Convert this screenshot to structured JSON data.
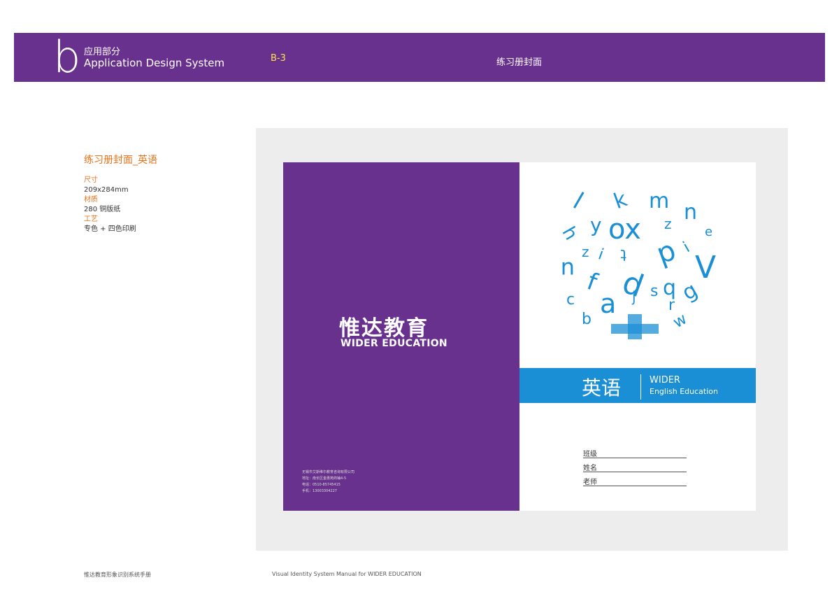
{
  "header": {
    "section_letter": "b",
    "section_cn": "应用部分",
    "section_en": "Application Design System",
    "page_code": "B-3",
    "page_title": "练习册封面"
  },
  "spec": {
    "title": "练习册封面_英语",
    "size_label": "尺寸",
    "size_value": "209x284mm",
    "material_label": "材质",
    "material_value": "280 铜版纸",
    "craft_label": "工艺",
    "craft_value": "专色 + 四色印刷"
  },
  "back_cover": {
    "brand_cn": "惟达教育",
    "brand_en": "WIDER EDUCATION",
    "address_lines": [
      "无锡市艾斯维尔教育咨询有限公司",
      "地址：南长区金惠苑商铺4-5",
      "电话：0510-85745415",
      "手机：13003304227"
    ]
  },
  "front_cover": {
    "subject_cn": "英语",
    "subject_en_1": "WIDER",
    "subject_en_2": "English Education",
    "fields": [
      "班级",
      "姓名",
      "老师"
    ]
  },
  "footer": {
    "left": "惟达教育形象识别系统手册",
    "right": "Visual Identity System Manual for WIDER EDUCATION"
  },
  "colors": {
    "purple": "#68318d",
    "blue": "#1a8fd6",
    "orange": "#e8731c",
    "yellow": "#ffe14a"
  }
}
